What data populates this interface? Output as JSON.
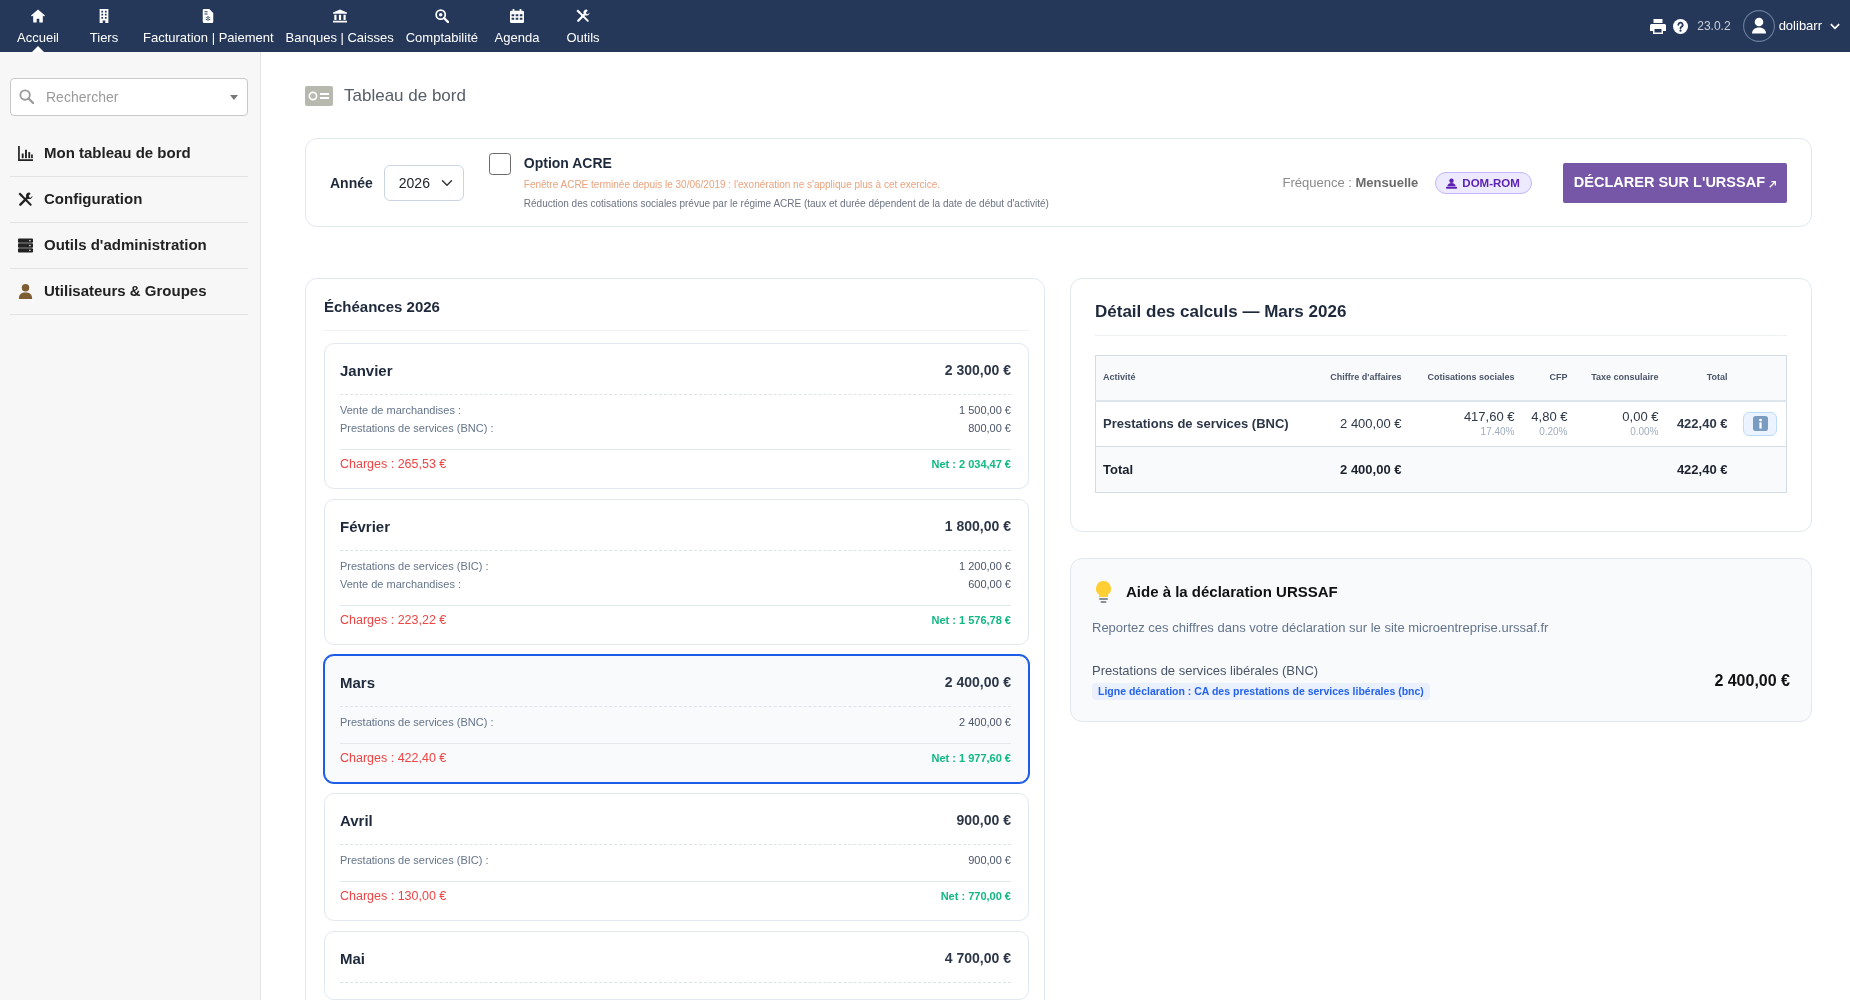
{
  "topbar": {
    "menu": [
      {
        "label": "Accueil",
        "selected": true
      },
      {
        "label": "Tiers",
        "selected": false
      },
      {
        "label": "Facturation | Paiement",
        "selected": false
      },
      {
        "label": "Banques | Caisses",
        "selected": false
      },
      {
        "label": "Comptabilité",
        "selected": false
      },
      {
        "label": "Agenda",
        "selected": false
      },
      {
        "label": "Outils",
        "selected": false
      }
    ],
    "version": "23.0.2",
    "user": "dolibarr"
  },
  "sidebar": {
    "search": {
      "placeholder": "Rechercher"
    },
    "items": [
      "Mon tableau de bord",
      "Configuration",
      "Outils d'administration",
      "Utilisateurs & Groupes"
    ]
  },
  "page": {
    "title": "Tableau de bord"
  },
  "settings": {
    "year_label": "Année",
    "year": "2026",
    "acre": {
      "label": "Option ACRE",
      "checked": false,
      "warning": "Fenêtre ACRE terminée depuis le 30/06/2019 : l'exonération ne s'applique plus à cet exercice.",
      "note": "Réduction des cotisations sociales prévue par le régime ACRE (taux et durée dépendent de la date de début d'activité)"
    },
    "frequency": "Fréquence : **Mensuelle**",
    "region": "DOM-ROM",
    "declare_button": "DÉCLARER SUR L'URSSAF"
  },
  "schedule": {
    "title": "Échéances 2026",
    "months": [
      {
        "name": "Janvier",
        "total": "2 300,00 €",
        "selected": false,
        "items": [
          {
            "label": "Vente de marchandises :",
            "amount": "1 500,00 €"
          },
          {
            "label": "Prestations de services (BNC) :",
            "amount": "800,00 €"
          }
        ],
        "charges": "Charges : 265,53 €",
        "net": "Net : 2 034,47 €"
      },
      {
        "name": "Février",
        "total": "1 800,00 €",
        "selected": false,
        "items": [
          {
            "label": "Prestations de services (BIC) :",
            "amount": "1 200,00 €"
          },
          {
            "label": "Vente de marchandises :",
            "amount": "600,00 €"
          }
        ],
        "charges": "Charges : 223,22 €",
        "net": "Net : 1 576,78 €"
      },
      {
        "name": "Mars",
        "total": "2 400,00 €",
        "selected": true,
        "items": [
          {
            "label": "Prestations de services (BNC) :",
            "amount": "2 400,00 €"
          }
        ],
        "charges": "Charges : 422,40 €",
        "net": "Net : 1 977,60 €"
      },
      {
        "name": "Avril",
        "total": "900,00 €",
        "selected": false,
        "items": [
          {
            "label": "Prestations de services (BIC) :",
            "amount": "900,00 €"
          }
        ],
        "charges": "Charges : 130,00 €",
        "net": "Net : 770,00 €"
      },
      {
        "name": "Mai",
        "total": "4 700,00 €",
        "selected": false
      }
    ]
  },
  "detail": {
    "title": "Détail des calculs — Mars 2026",
    "table": {
      "columns": [
        "Activité",
        "Chiffre d'affaires",
        "Cotisations sociales",
        "CFP",
        "Taxe consulaire",
        "Total"
      ],
      "rows": [
        {
          "activity": "Prestations de services (BNC)",
          "revenue": "2 400,00 €",
          "social": {
            "amount": "417,60 €",
            "rate": "17.40%"
          },
          "cfp": {
            "amount": "4,80 €",
            "rate": "0.20%"
          },
          "consular": {
            "amount": "0,00 €",
            "rate": "0.00%"
          },
          "total": "422,40 €"
        }
      ],
      "total_row": {
        "label": "Total",
        "revenue": "2 400,00 €",
        "total": "422,40 €"
      }
    }
  },
  "help": {
    "title": "Aide à la déclaration URSSAF",
    "text": "Reportez ces chiffres dans votre déclaration sur le site microentreprise.urssaf.fr",
    "lines": [
      {
        "label": "Prestations de services libérales (BNC)",
        "declaration": "Ligne déclaration : CA des prestations de services libérales (bnc)",
        "amount": "2 400,00 €"
      }
    ]
  }
}
